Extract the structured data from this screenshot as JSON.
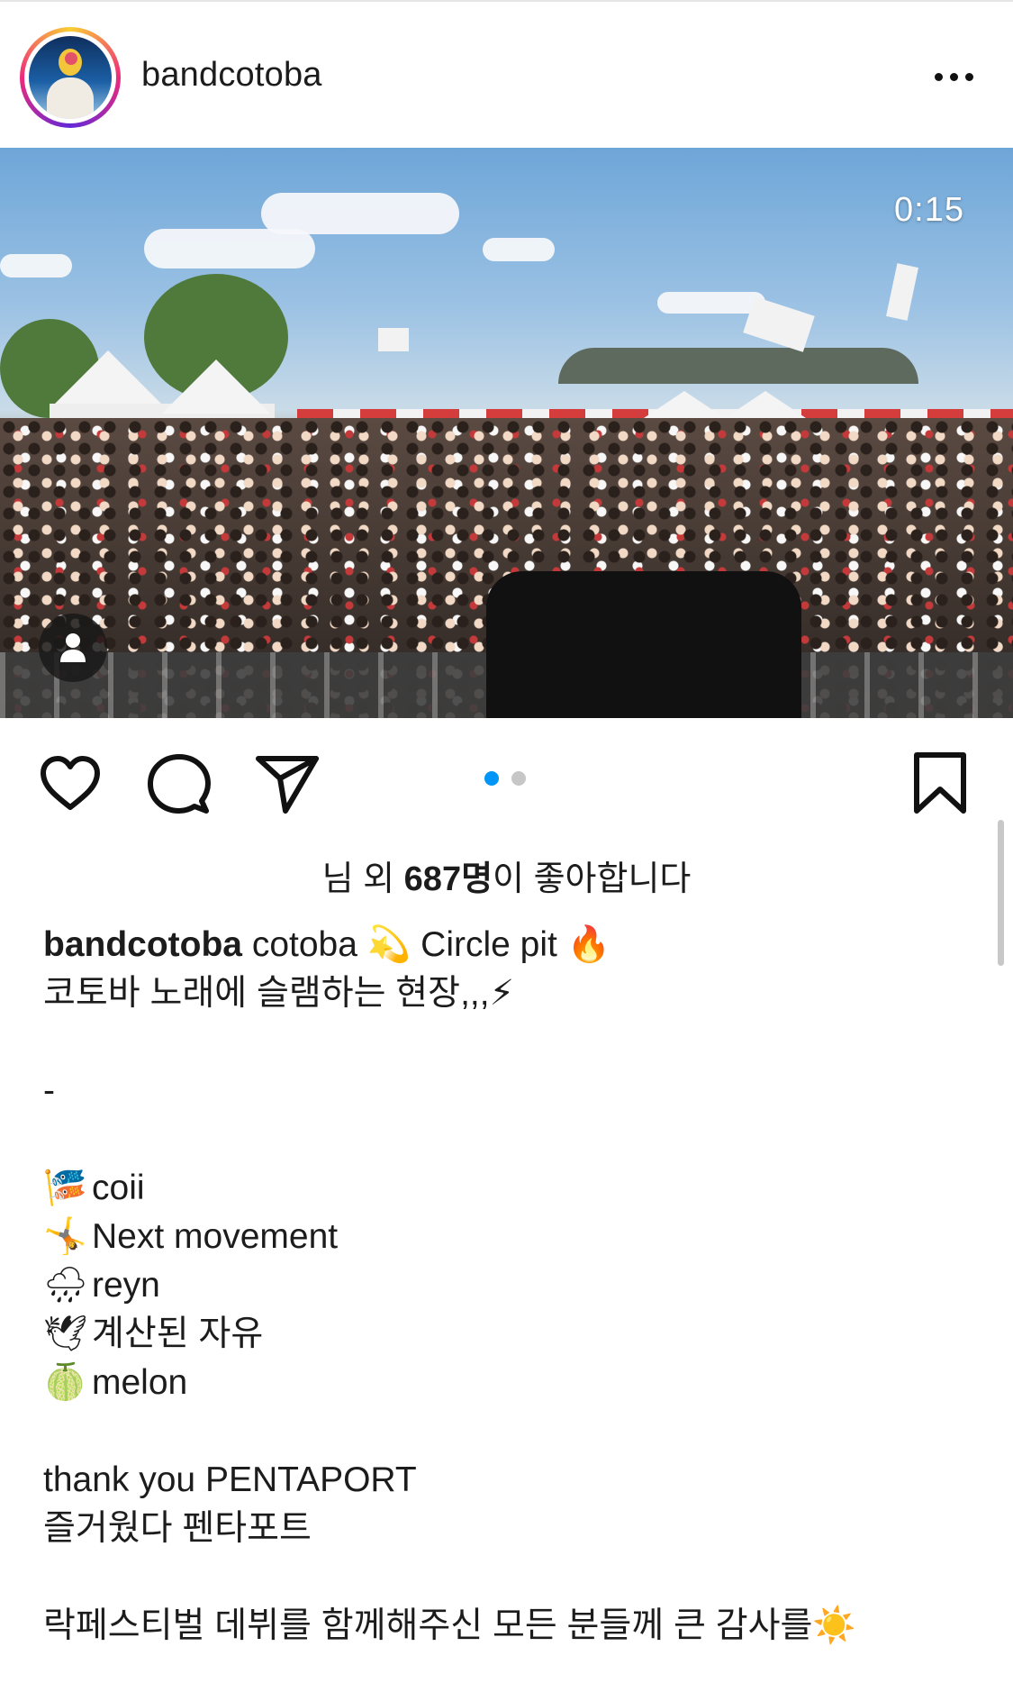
{
  "post": {
    "author": "bandcotoba",
    "video_duration": "0:15",
    "carousel": {
      "count": 2,
      "active_index": 0
    },
    "colors": {
      "active_dot": "#0095f6",
      "inactive_dot": "#c7c7c7",
      "text": "#1c1c1c"
    }
  },
  "icons": {
    "more": "more-options-icon",
    "like": "heart-icon",
    "comment": "comment-icon",
    "share": "send-icon",
    "save": "bookmark-icon",
    "tag": "person-tag-icon"
  },
  "likes": {
    "prefix": "님 외 ",
    "count": "687명",
    "suffix": "이 좋아합니다"
  },
  "caption": {
    "username": "bandcotoba",
    "line1_text": " cotoba ",
    "line1_emoji1": "💫",
    "line1_mid": " Circle pit ",
    "line1_emoji2": "🔥",
    "line2_text": "코토바 노래에 슬램하는 현장,,,",
    "line2_emoji": "⚡",
    "separator": "-",
    "setlist": [
      {
        "emoji": "🎏",
        "title": "coii"
      },
      {
        "emoji": "🤸",
        "title": "Next movement"
      },
      {
        "emoji": "🌧",
        "title": "reyn"
      },
      {
        "emoji": "🕊",
        "title": "계산된 자유"
      },
      {
        "emoji": "🍈",
        "title": "melon"
      }
    ],
    "thanks_en": "thank you PENTAPORT",
    "thanks_ko": "즐거웠다 펜타포트",
    "closing_text": "락페스티벌 데뷔를 함께해주신 모든 분들께 큰 감사를",
    "closing_emoji": "☀️"
  }
}
